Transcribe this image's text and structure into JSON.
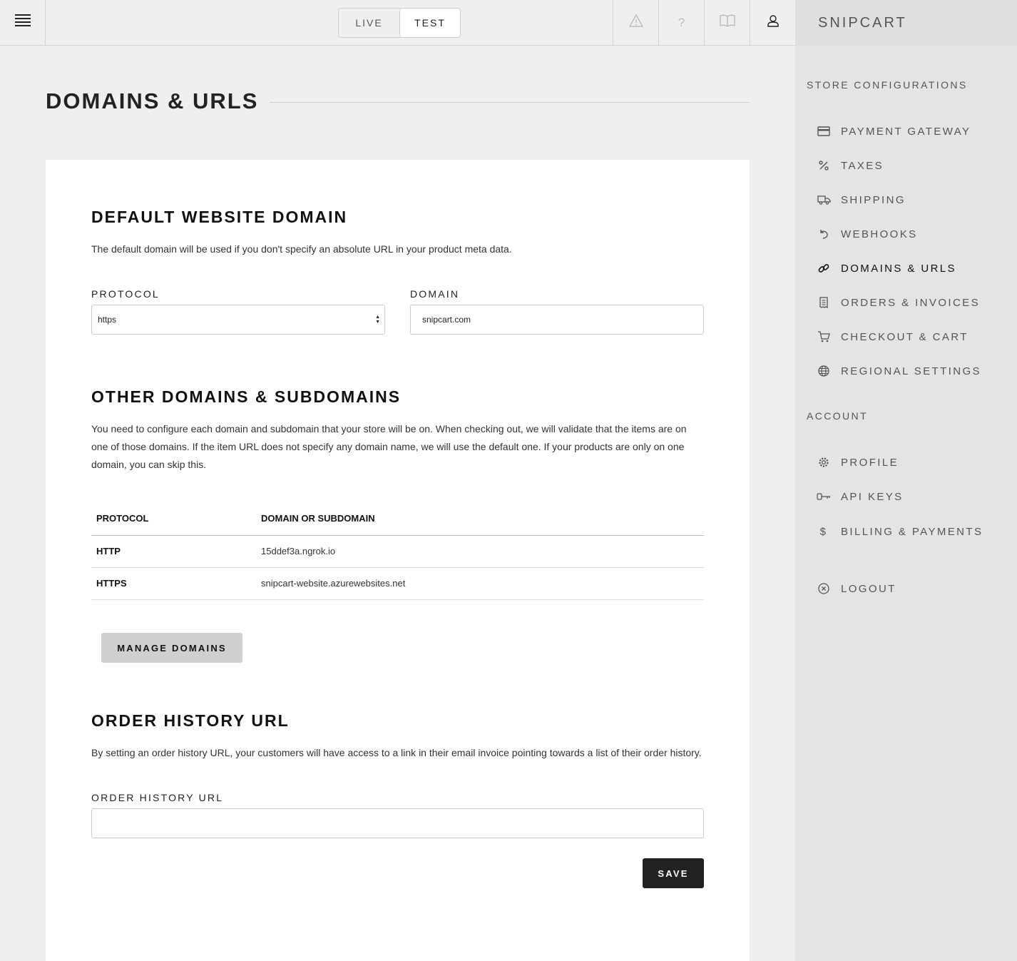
{
  "topbar": {
    "menu_icon": "hamburger-menu-icon",
    "mode": {
      "live": "LIVE",
      "test": "TEST",
      "selected": "TEST"
    },
    "icons": [
      "warning-icon",
      "help-icon",
      "docs-book-icon",
      "user-account-icon"
    ]
  },
  "sidebar": {
    "brand": "SNIPCART",
    "store_section": "STORE CONFIGURATIONS",
    "store_items": [
      {
        "label": "PAYMENT GATEWAY",
        "icon": "credit-card-icon"
      },
      {
        "label": "TAXES",
        "icon": "percent-icon"
      },
      {
        "label": "SHIPPING",
        "icon": "truck-icon"
      },
      {
        "label": "WEBHOOKS",
        "icon": "undo-arrow-icon"
      },
      {
        "label": "DOMAINS & URLS",
        "icon": "link-icon",
        "active": true
      },
      {
        "label": "ORDERS & INVOICES",
        "icon": "receipt-icon"
      },
      {
        "label": "CHECKOUT & CART",
        "icon": "cart-icon"
      },
      {
        "label": "REGIONAL SETTINGS",
        "icon": "globe-icon"
      }
    ],
    "account_section": "ACCOUNT",
    "account_items": [
      {
        "label": "PROFILE",
        "icon": "gear-icon"
      },
      {
        "label": "API KEYS",
        "icon": "key-icon"
      },
      {
        "label": "BILLING & PAYMENTS",
        "icon": "dollar-icon"
      }
    ],
    "logout": {
      "label": "LOGOUT",
      "icon": "close-circle-icon"
    }
  },
  "page": {
    "title": "DOMAINS & URLS"
  },
  "default_domain": {
    "heading": "DEFAULT WEBSITE DOMAIN",
    "description": "The default domain will be used if you don't specify an absolute URL in your product meta data.",
    "protocol_label": "PROTOCOL",
    "protocol_value": "https",
    "domain_label": "DOMAIN",
    "domain_value": "snipcart.com"
  },
  "other_domains": {
    "heading": "OTHER DOMAINS & SUBDOMAINS",
    "description": "You need to configure each domain and subdomain that your store will be on. When checking out, we will validate that the items are on one of those domains. If the item URL does not specify any domain name, we will use the default one. If your products are only on one domain, you can skip this.",
    "columns": [
      "PROTOCOL",
      "DOMAIN OR SUBDOMAIN"
    ],
    "rows": [
      {
        "protocol": "HTTP",
        "domain": "15ddef3a.ngrok.io"
      },
      {
        "protocol": "HTTPS",
        "domain": "snipcart-website.azurewebsites.net"
      }
    ],
    "manage_button": "MANAGE DOMAINS"
  },
  "order_history": {
    "heading": "ORDER HISTORY URL",
    "description": "By setting an order history URL, your customers will have access to a link in their email invoice pointing towards a list of their order history.",
    "field_label": "ORDER HISTORY URL",
    "field_value": "",
    "save_button": "SAVE"
  }
}
